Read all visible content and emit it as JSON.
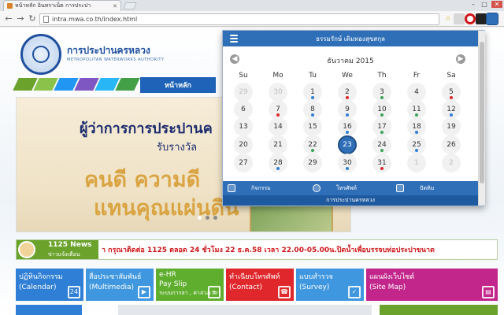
{
  "browser": {
    "tab_title": "หน้าหลัก อินทราเน็ต การประปา",
    "url": "intra.mwa.co.th/index.html"
  },
  "site": {
    "org_name": "การประปานครหลวง",
    "org_sub": "METROPOLITAN WATERWORKS AUTHORITY",
    "nav_home": "หน้าหลัก"
  },
  "banner": {
    "line1": "ผู้ว่าการการประปานค",
    "line2": "รับรางวัล",
    "line3": "คนดี ความดี",
    "line4": "แทนคุณแผ่นดิน"
  },
  "news": {
    "title": "1125 News",
    "subtitle": "ข่าวแจ้งเตือน",
    "text": "า กรุณาติดต่อ 1125 ตลอด 24 ชั่วโมง 22 ธ.ค.58 เวลา 22.00-05.00น.ปิดน้ำเพื่อบรรจบท่อประปาขนาด"
  },
  "tiles": [
    {
      "title": "ปฏิทินกิจกรรม",
      "sub": "(Calendar)",
      "color": "#2f7fd6",
      "icon": "calendar-icon",
      "glyph": "24"
    },
    {
      "title": "สื่อประชาสัมพันธ์",
      "sub": "(Multimedia)",
      "color": "#3f97e0",
      "icon": "video-icon",
      "glyph": "▶"
    },
    {
      "title": "e-HR",
      "sub": "Pay Slip",
      "extra": "ระบบการลา , ค่าล่วงเวลา",
      "color": "#5fae2e",
      "icon": "people-icon",
      "glyph": "+"
    },
    {
      "title": "ทำเนียบโทรศัพท์",
      "sub": "(Contact)",
      "color": "#e0272b",
      "icon": "phone-icon",
      "glyph": "☎"
    },
    {
      "title": "แบบสำรวจ",
      "sub": "(Survey)",
      "color": "#3f97e0",
      "icon": "survey-icon",
      "glyph": "✓"
    },
    {
      "title": "แผนผังเว็บไซต์",
      "sub": "(Site Map)",
      "color": "#c2268b",
      "icon": "sitemap-icon",
      "glyph": "▤"
    }
  ],
  "calendar": {
    "user": "ธรรมรักษ์ เดิมทองสุขสกุล",
    "month": "ธันวาคม 2015",
    "prev": "◀",
    "next": "▶",
    "weekdays": [
      "Su",
      "Mo",
      "Tu",
      "We",
      "Th",
      "Fr",
      "Sa"
    ],
    "today": "23",
    "weeks": [
      [
        "29",
        "30",
        "1",
        "2",
        "3",
        "4",
        "5"
      ],
      [
        "6",
        "7",
        "8",
        "9",
        "10",
        "11",
        "12"
      ],
      [
        "13",
        "14",
        "15",
        "16",
        "17",
        "18",
        "19"
      ],
      [
        "20",
        "21",
        "22",
        "23",
        "24",
        "25",
        "26"
      ],
      [
        "27",
        "28",
        "29",
        "30",
        "31",
        "1",
        "2"
      ]
    ],
    "footer": [
      "กิจกรรม",
      "โทรศัพท์",
      "ปัตทิม"
    ],
    "org": "การประปานครหลวง"
  },
  "colors": {
    "accent": "#2f6fb8",
    "event_red": "#e0272b",
    "event_blue": "#2f7fd6",
    "event_green": "#3aa35a"
  }
}
